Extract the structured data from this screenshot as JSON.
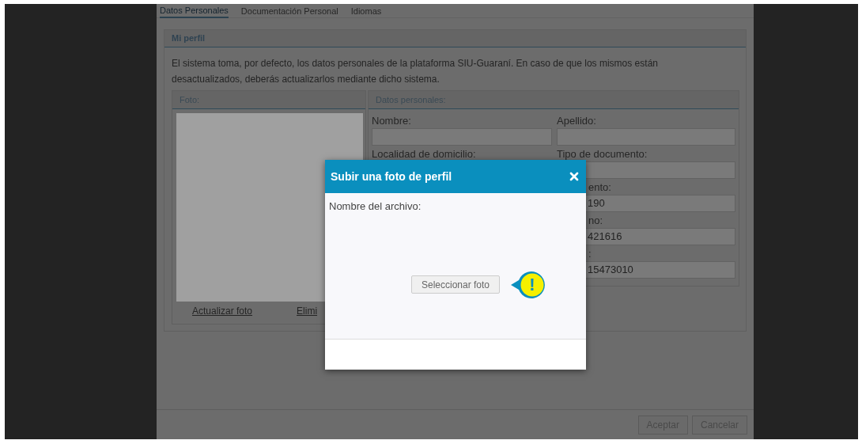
{
  "tabs": [
    {
      "label": "Datos Personales",
      "selected": true
    },
    {
      "label": "Documentación Personal",
      "selected": false
    },
    {
      "label": "Idiomas",
      "selected": false
    }
  ],
  "profile": {
    "title": "Mi perfil",
    "notice": [
      "El sistema toma, por defecto, los datos personales de la plataforma SIU-Guaraní. En caso de que los mismos están",
      "desactualizados, deberás actualizarlos mediante dicho sistema."
    ],
    "photo_panel": {
      "title": "Foto:",
      "links": [
        "Actualizar foto",
        "Elimi"
      ]
    },
    "personal_panel": {
      "title": "Datos personales:",
      "left_fields": [
        {
          "label": "Nombre:",
          "clipped": false,
          "has_input": true
        },
        {
          "label": "Localidad de domicilio:",
          "clipped": false,
          "has_input": false
        }
      ],
      "right_fields": [
        {
          "label": "Apellido:",
          "clipped": false,
          "has_input": true
        },
        {
          "label": "Tipo de documento:",
          "clipped": false,
          "has_input": true
        },
        {
          "label": "ento:",
          "value": "190",
          "clipped": true,
          "has_input": true
        },
        {
          "label": "no:",
          "value": "421616",
          "clipped": true,
          "has_input": true
        },
        {
          "label": ":",
          "value": "15473010",
          "clipped": true,
          "has_input": true
        }
      ]
    }
  },
  "footer_buttons": [
    "Aceptar",
    "Cancelar"
  ],
  "dialog": {
    "title": "Subir una foto de perfil",
    "file_label": "Nombre del archivo:",
    "select_button": "Seleccionar foto",
    "hint_badge": "!"
  }
}
